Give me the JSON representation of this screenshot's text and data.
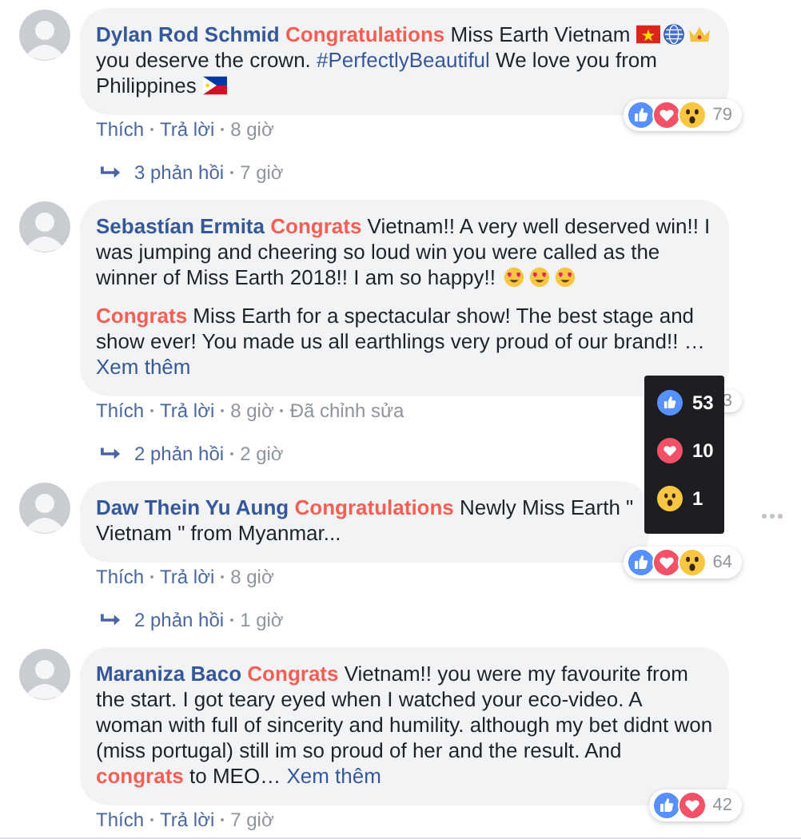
{
  "comments": [
    {
      "author": "Dylan Rod Schmid",
      "paragraphs": [
        [
          {
            "kind": "text",
            "text": "**Congratulations** Miss Earth Vietnam "
          },
          {
            "kind": "flag-vn"
          },
          {
            "kind": "globe"
          },
          {
            "kind": "crown"
          },
          {
            "kind": "text",
            "text": " you deserve the crown. "
          },
          {
            "kind": "hashtag",
            "text": "#PerfectlyBeautiful"
          },
          {
            "kind": "text",
            "text": " We love you from Philippines "
          },
          {
            "kind": "flag-ph"
          }
        ]
      ],
      "actions": [
        {
          "kind": "link",
          "text": "Thích"
        },
        {
          "kind": "link",
          "text": "Trả lời"
        },
        {
          "kind": "meta",
          "text": "8 giờ"
        }
      ],
      "reactions": {
        "icons": [
          {
            "kind": "like"
          },
          {
            "kind": "love"
          },
          {
            "kind": "wow"
          }
        ],
        "count": "79"
      },
      "replies": {
        "label": "3 phản hồi",
        "time": "7 giờ"
      }
    },
    {
      "author": "Sebastían Ermita",
      "paragraphs": [
        [
          {
            "kind": "text",
            "text": "**Congrats** Vietnam!! A very well deserved win!! I was jumping and cheering so loud win you were called as the winner of Miss Earth 2018!! I am so happy!! "
          },
          {
            "kind": "heart-eyes"
          },
          {
            "kind": "heart-eyes"
          },
          {
            "kind": "heart-eyes"
          }
        ],
        [
          {
            "kind": "text",
            "text": "**Congrats** Miss Earth for a spectacular show! The best stage and show ever! You made us all earthlings very proud of our brand!! … "
          },
          {
            "kind": "link",
            "text": "Xem thêm"
          }
        ]
      ],
      "actions": [
        {
          "kind": "link",
          "text": "Thích"
        },
        {
          "kind": "link",
          "text": "Trả lời"
        },
        {
          "kind": "meta",
          "text": "8 giờ"
        },
        {
          "kind": "meta",
          "text": "Đã chỉnh sửa"
        }
      ],
      "reactions": {
        "count": "3"
      },
      "replies": {
        "label": "2 phản hồi",
        "time": "2 giờ"
      }
    },
    {
      "author": "Daw Thein Yu Aung",
      "paragraphs": [
        [
          {
            "kind": "text",
            "text": "**Congratulations** Newly Miss Earth \"\nVietnam \" from Myanmar..."
          }
        ]
      ],
      "more_menu": true,
      "actions": [
        {
          "kind": "link",
          "text": "Thích"
        },
        {
          "kind": "link",
          "text": "Trả lời"
        },
        {
          "kind": "meta",
          "text": "8 giờ"
        }
      ],
      "reactions": {
        "icons": [
          {
            "kind": "like"
          },
          {
            "kind": "love"
          },
          {
            "kind": "wow"
          }
        ],
        "count": "64"
      },
      "replies": {
        "label": "2 phản hồi",
        "time": "1 giờ"
      }
    },
    {
      "author": "Maraniza Baco",
      "paragraphs": [
        [
          {
            "kind": "text",
            "text": "**Congrats** Vietnam!! you were my favourite from the start. I got teary eyed when I watched your eco-video. A woman with full of sincerity and humility. although my bet didnt won (miss portugal) still im so proud of her and the result. And **congrats** to MEO… "
          },
          {
            "kind": "link",
            "text": "Xem thêm"
          }
        ]
      ],
      "actions": [
        {
          "kind": "link",
          "text": "Thích"
        },
        {
          "kind": "link",
          "text": "Trả lời"
        },
        {
          "kind": "meta",
          "text": "7 giờ"
        }
      ],
      "reactions": {
        "icons": [
          {
            "kind": "like"
          },
          {
            "kind": "love"
          }
        ],
        "count": "42"
      }
    }
  ],
  "reaction_tooltip": {
    "rows": [
      {
        "kind": "like",
        "count": "53"
      },
      {
        "kind": "love",
        "count": "10"
      },
      {
        "kind": "wow",
        "count": "1"
      }
    ]
  }
}
